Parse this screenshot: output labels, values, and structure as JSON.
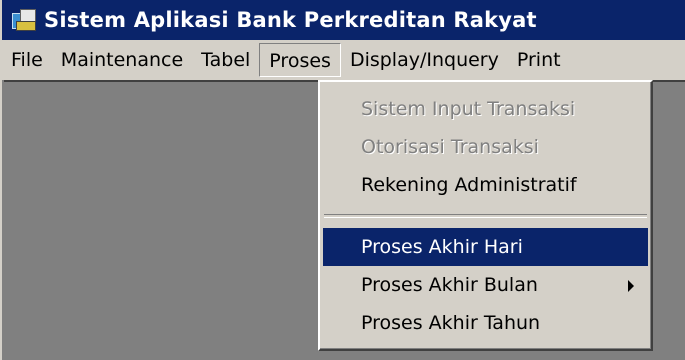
{
  "window": {
    "title": "Sistem Aplikasi Bank Perkreditan Rakyat",
    "app_icon": "bank-app-icon"
  },
  "menubar": {
    "items": [
      {
        "label": "File"
      },
      {
        "label": "Maintenance"
      },
      {
        "label": "Tabel"
      },
      {
        "label": "Proses",
        "open": true
      },
      {
        "label": "Display/Inquery"
      },
      {
        "label": "Print"
      }
    ]
  },
  "proses_menu": {
    "items": [
      {
        "label": "Sistem Input Transaksi",
        "disabled": true
      },
      {
        "label": "Otorisasi Transaksi",
        "disabled": true
      },
      {
        "label": "Rekening Administratif",
        "disabled": false
      },
      {
        "label": "Proses Akhir Hari",
        "selected": true
      },
      {
        "label": "Proses Akhir Bulan",
        "has_submenu": true
      },
      {
        "label": "Proses Akhir Tahun"
      }
    ],
    "submenu_icon": "chevron-right-icon"
  },
  "colors": {
    "titlebar": "#0a246a",
    "menu_face": "#d4d0c8",
    "client_bg": "#808080",
    "selection": "#0a246a",
    "disabled_text": "#808080"
  }
}
